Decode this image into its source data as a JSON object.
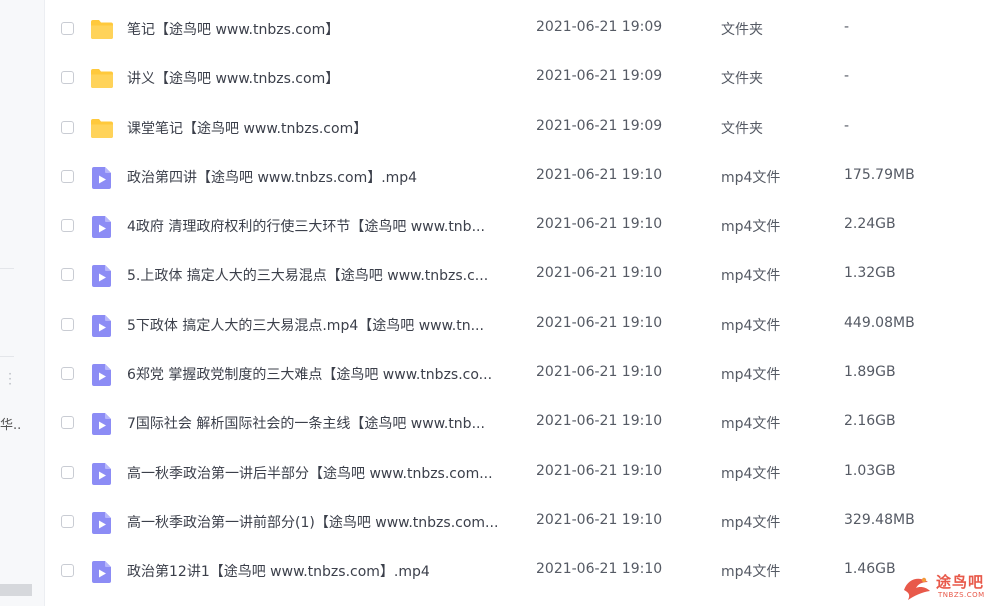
{
  "sidebar": {
    "truncated_text": "华..."
  },
  "files": [
    {
      "icon": "folder-icon",
      "name": "笔记【途鸟吧 www.tnbzs.com】",
      "date": "2021-06-21 19:09",
      "type": "文件夹",
      "size": "-"
    },
    {
      "icon": "folder-icon",
      "name": "讲义【途鸟吧 www.tnbzs.com】",
      "date": "2021-06-21 19:09",
      "type": "文件夹",
      "size": "-"
    },
    {
      "icon": "folder-icon",
      "name": "课堂笔记【途鸟吧 www.tnbzs.com】",
      "date": "2021-06-21 19:09",
      "type": "文件夹",
      "size": "-"
    },
    {
      "icon": "video-file-icon",
      "name": "政治第四讲【途鸟吧 www.tnbzs.com】.mp4",
      "date": "2021-06-21 19:10",
      "type": "mp4文件",
      "size": "175.79MB"
    },
    {
      "icon": "video-file-icon",
      "name": "4政府 清理政府权利的行使三大环节【途鸟吧 www.tnb...",
      "date": "2021-06-21 19:10",
      "type": "mp4文件",
      "size": "2.24GB"
    },
    {
      "icon": "video-file-icon",
      "name": "5.上政体 搞定人大的三大易混点【途鸟吧 www.tnbzs.c...",
      "date": "2021-06-21 19:10",
      "type": "mp4文件",
      "size": "1.32GB"
    },
    {
      "icon": "video-file-icon",
      "name": "5下政体 搞定人大的三大易混点.mp4【途鸟吧 www.tn...",
      "date": "2021-06-21 19:10",
      "type": "mp4文件",
      "size": "449.08MB"
    },
    {
      "icon": "video-file-icon",
      "name": "6郑党 掌握政党制度的三大难点【途鸟吧 www.tnbzs.co...",
      "date": "2021-06-21 19:10",
      "type": "mp4文件",
      "size": "1.89GB"
    },
    {
      "icon": "video-file-icon",
      "name": "7国际社会 解析国际社会的一条主线【途鸟吧 www.tnb...",
      "date": "2021-06-21 19:10",
      "type": "mp4文件",
      "size": "2.16GB"
    },
    {
      "icon": "video-file-icon",
      "name": "高一秋季政治第一讲后半部分【途鸟吧 www.tnbzs.com...",
      "date": "2021-06-21 19:10",
      "type": "mp4文件",
      "size": "1.03GB"
    },
    {
      "icon": "video-file-icon",
      "name": "高一秋季政治第一讲前部分(1)【途鸟吧 www.tnbzs.com...",
      "date": "2021-06-21 19:10",
      "type": "mp4文件",
      "size": "329.48MB"
    },
    {
      "icon": "video-file-icon",
      "name": "政治第12讲1【途鸟吧 www.tnbzs.com】.mp4",
      "date": "2021-06-21 19:10",
      "type": "mp4文件",
      "size": "1.46GB"
    }
  ],
  "watermark": {
    "text": "途鸟吧",
    "url": "TNBZS.COM"
  },
  "colors": {
    "folder": "#ffc93c",
    "video": "#8c8cf5",
    "watermark": "#e8594a"
  }
}
